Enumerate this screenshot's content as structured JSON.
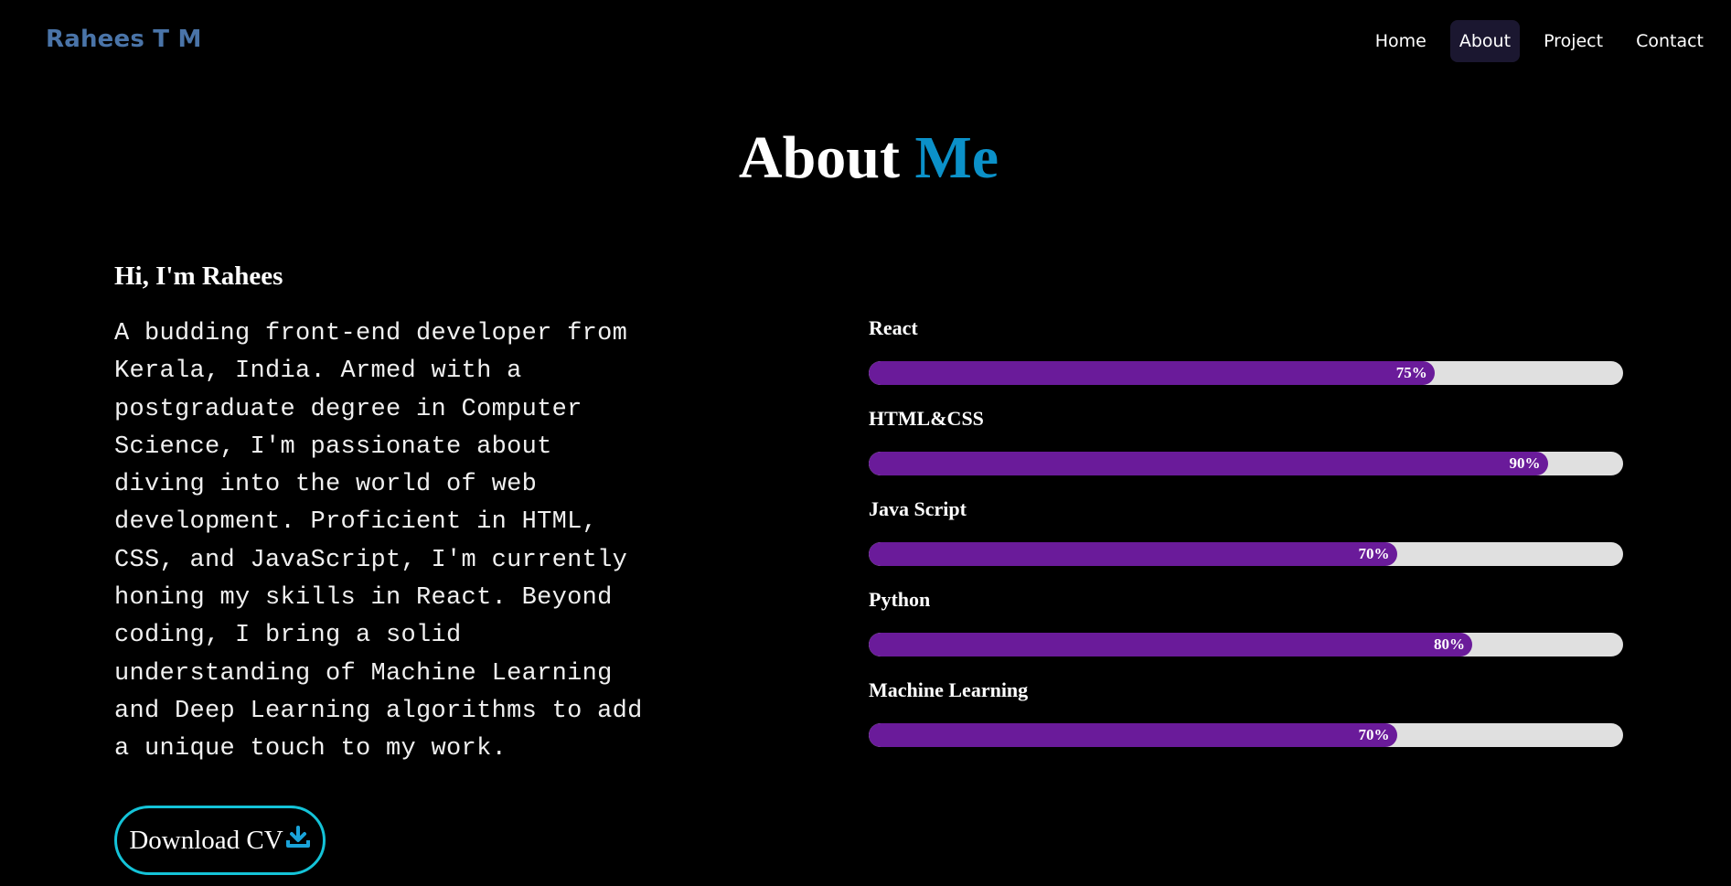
{
  "nav": {
    "brand": "Rahees T M",
    "links": [
      "Home",
      "About",
      "Project",
      "Contact"
    ],
    "active_link": "About"
  },
  "about": {
    "title_main": "About",
    "title_accent": "Me",
    "greeting": "Hi, I'm Rahees",
    "bio": "A budding front-end developer from Kerala, India. Armed with a postgraduate degree in Computer Science, I'm passionate about diving into the world of web development. Proficient in HTML, CSS, and JavaScript, I'm currently honing my skills in React. Beyond coding, I bring a solid understanding of Machine Learning and Deep Learning algorithms to add a unique touch to my work.",
    "download_label": "Download CV",
    "download_icon": "download-icon"
  },
  "skills": [
    {
      "name": "React",
      "percent": 75,
      "percent_label": "75%"
    },
    {
      "name": "HTML&CSS",
      "percent": 90,
      "percent_label": "90%"
    },
    {
      "name": "Java Script",
      "percent": 70,
      "percent_label": "70%"
    },
    {
      "name": "Python",
      "percent": 80,
      "percent_label": "80%"
    },
    {
      "name": "Machine Learning",
      "percent": 70,
      "percent_label": "70%"
    }
  ],
  "colors": {
    "background": "#000000",
    "brand": "#4a74a8",
    "accent": "#0b91c9",
    "bar_fill": "#6a1b9a",
    "bar_track": "#e0e0e0",
    "button_border": "#14c3d8",
    "nav_active_bg": "#1b1730"
  }
}
